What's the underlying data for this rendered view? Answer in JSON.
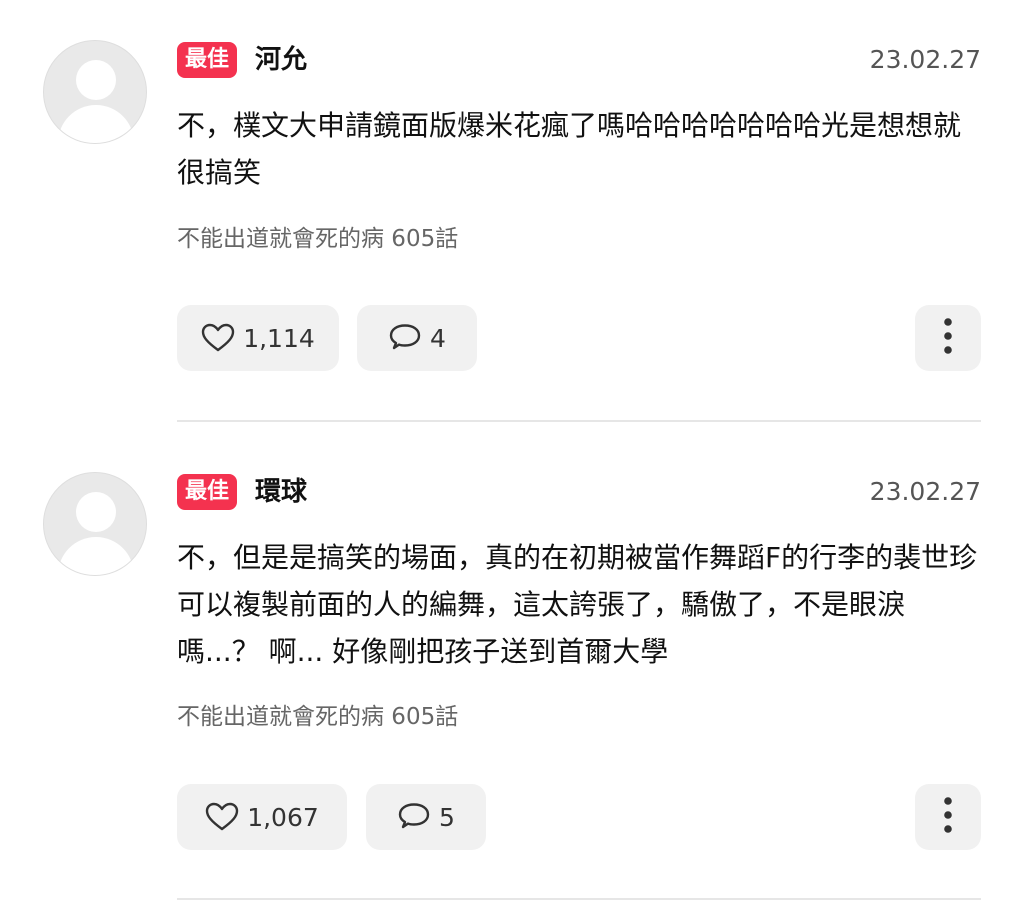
{
  "comments": [
    {
      "badge": "最佳",
      "author": "河允",
      "date": "23.02.27",
      "text": "不，樸文大申請鏡面版爆米花瘋了嗎哈哈哈哈哈哈哈光是想想就很搞笑",
      "source": "不能出道就會死的病 605話",
      "likes": "1,114",
      "replies": "4"
    },
    {
      "badge": "最佳",
      "author": "環球",
      "date": "23.02.27",
      "text": "不，但是是搞笑的場面，真的在初期被當作舞蹈F的行李的裴世珍可以複製前面的人的編舞，這太誇張了，驕傲了，不是眼淚嗎...？ 啊... 好像剛把孩子送到首爾大學",
      "source": "不能出道就會死的病 605話",
      "likes": "1,067",
      "replies": "5"
    }
  ],
  "icons": {
    "like": "heart-outline-icon",
    "reply": "speech-bubble-icon",
    "more": "vertical-dots-icon",
    "avatar": "default-user-avatar-icon"
  },
  "colors": {
    "badge": "#f4324f",
    "pill": "#f1f1f1",
    "divider": "#e6e6e6"
  }
}
